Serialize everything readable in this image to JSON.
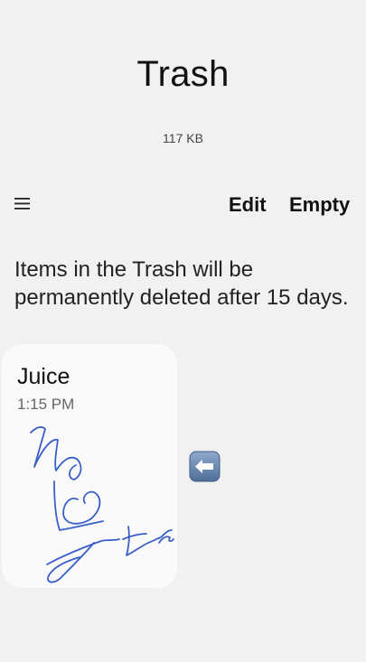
{
  "header": {
    "title": "Trash",
    "size": "117 KB"
  },
  "toolbar": {
    "menu_icon": "hamburger-menu-icon",
    "edit_label": "Edit",
    "empty_label": "Empty"
  },
  "notice": "Items in the Trash will be permanently deleted after 15 days.",
  "notes": [
    {
      "title": "Juice",
      "time": "1:15 PM",
      "thumbnail": "handwritten-sketch",
      "ink_color": "#3a5fc8"
    }
  ],
  "floating_icon": "left-arrow-emoji-icon",
  "colors": {
    "background": "#f1f1f1",
    "card": "#fafafa",
    "ink": "#3a5fc8",
    "arrow_button": "#5f7ea8"
  }
}
